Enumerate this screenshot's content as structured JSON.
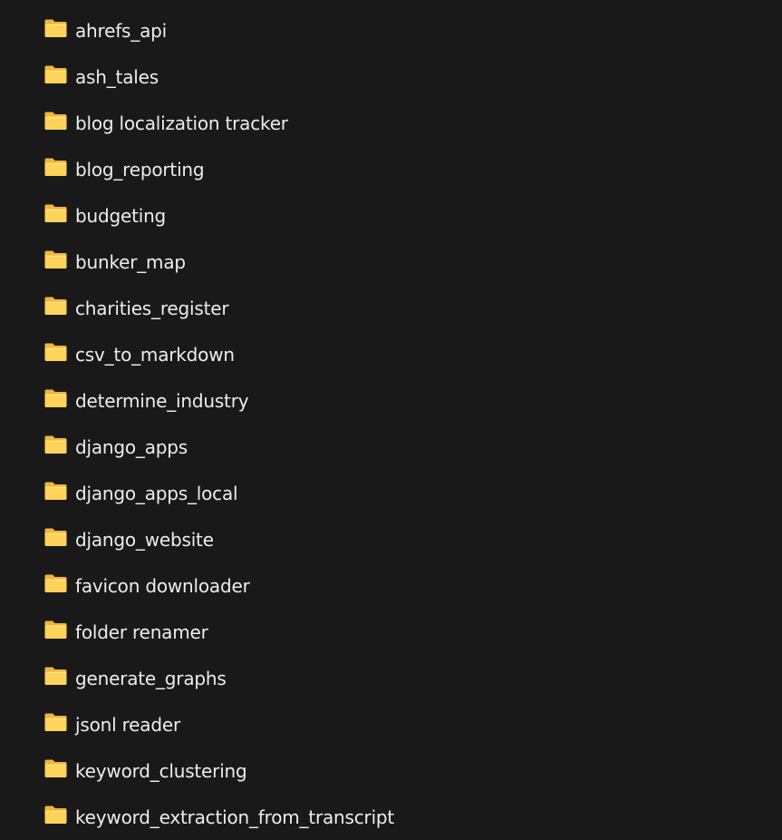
{
  "folder_icon": {
    "name": "folder-icon",
    "color_back": "#f1b53c",
    "color_front": "#ffd35a",
    "color_highlight": "#ffe694"
  },
  "folders": [
    {
      "name": "ahrefs_api"
    },
    {
      "name": "ash_tales"
    },
    {
      "name": "blog localization tracker"
    },
    {
      "name": "blog_reporting"
    },
    {
      "name": "budgeting"
    },
    {
      "name": "bunker_map"
    },
    {
      "name": "charities_register"
    },
    {
      "name": "csv_to_markdown"
    },
    {
      "name": "determine_industry"
    },
    {
      "name": "django_apps"
    },
    {
      "name": "django_apps_local"
    },
    {
      "name": "django_website"
    },
    {
      "name": "favicon downloader"
    },
    {
      "name": "folder renamer"
    },
    {
      "name": "generate_graphs"
    },
    {
      "name": "jsonl reader"
    },
    {
      "name": "keyword_clustering"
    },
    {
      "name": "keyword_extraction_from_transcript"
    }
  ]
}
